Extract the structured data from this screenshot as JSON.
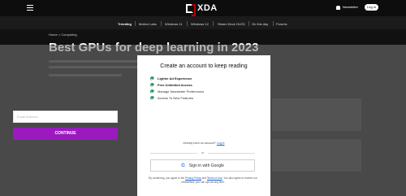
{
  "header": {
    "logo_text": "XDA",
    "newsletter_label": "Newsletter",
    "login_label": "Log in"
  },
  "nav": {
    "items": [
      "Trending",
      "Motion Labs",
      "Windows 11",
      "Windows 12",
      "Steam Deck OLED",
      "On this day",
      "Forums"
    ]
  },
  "page": {
    "breadcrumb": "Home > Computing",
    "title": "Best GPUs for deep learning in 2023"
  },
  "modal": {
    "title": "Create an account to keep reading",
    "benefits": [
      "Lighter Ad Experience",
      "Free Unlimited Access",
      "Manage Newsletter Preferences",
      "Access To New Features"
    ],
    "email_placeholder": "Email Address",
    "continue_label": "CONTINUE",
    "have_account_text": "Already have an account?",
    "login_link": "Log in",
    "or_text": "or",
    "google_label": "Sign in with Google",
    "terms_prefix": "By continuing, you agree to the",
    "privacy_link": "Privacy Policy",
    "and_text": "and",
    "terms_link": "Terms of Use",
    "terms_suffix": ". You also agree to receive our newsletters, you can opt-out any time."
  },
  "colors": {
    "accent_purple": "#9a1ac0",
    "check_green": "#2e9d6b",
    "header_bg": "#0d0d0d"
  }
}
